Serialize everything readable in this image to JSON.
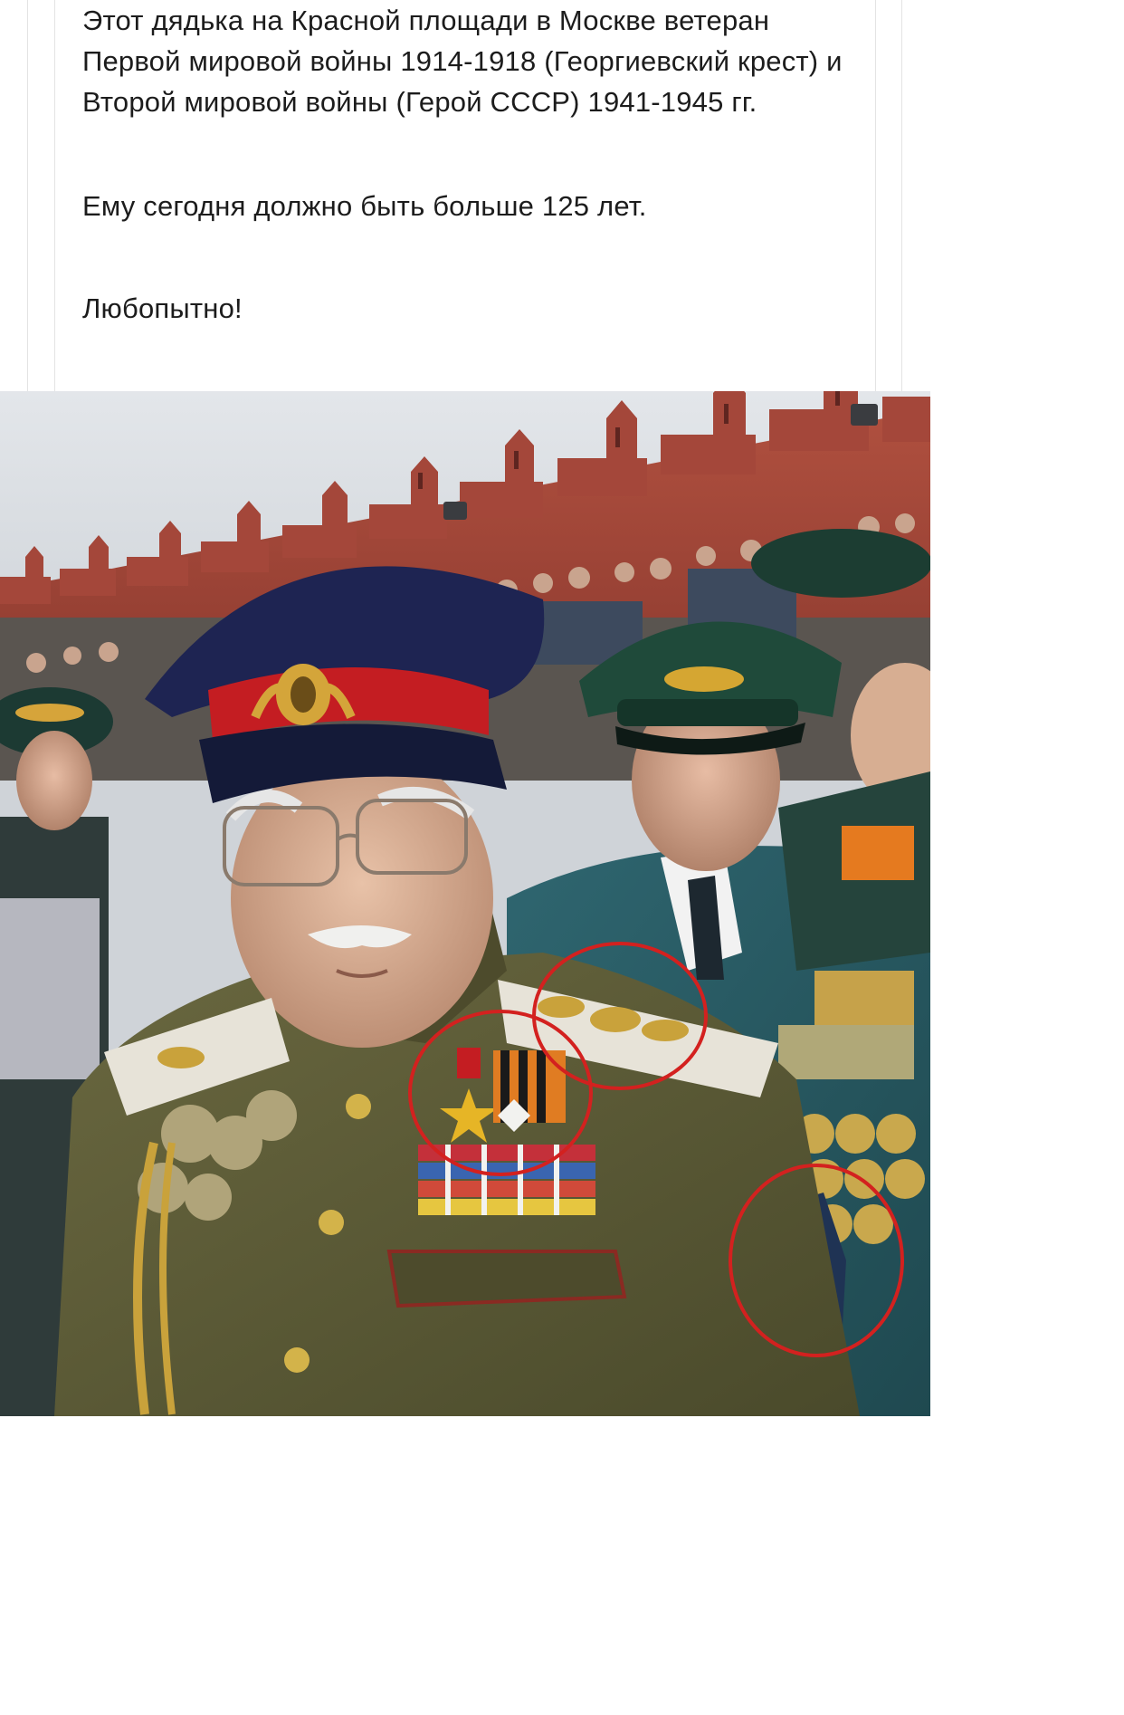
{
  "post": {
    "paragraph_1": "Этот дядька на Красной площади в Москве ветеран Первой мировой войны 1914-1918 (Георгиевский крест) и Второй мировой войны (Герой СССР) 1941-1945 гг.",
    "paragraph_2": "Ему сегодня должно быть больше 125 лет.",
    "paragraph_3": "Любопытно!"
  },
  "photo": {
    "colors": {
      "kremlin_wall": "#a1473a",
      "sky": "#d6dbe0",
      "uniform_olive": "#5b5a36",
      "cap_band_red": "#c41d22",
      "cap_crown": "#1e2452",
      "highlight_circle": "#d3211f",
      "green_cap": "#1f4a3a",
      "teal_uniform": "#2a5a62"
    }
  }
}
